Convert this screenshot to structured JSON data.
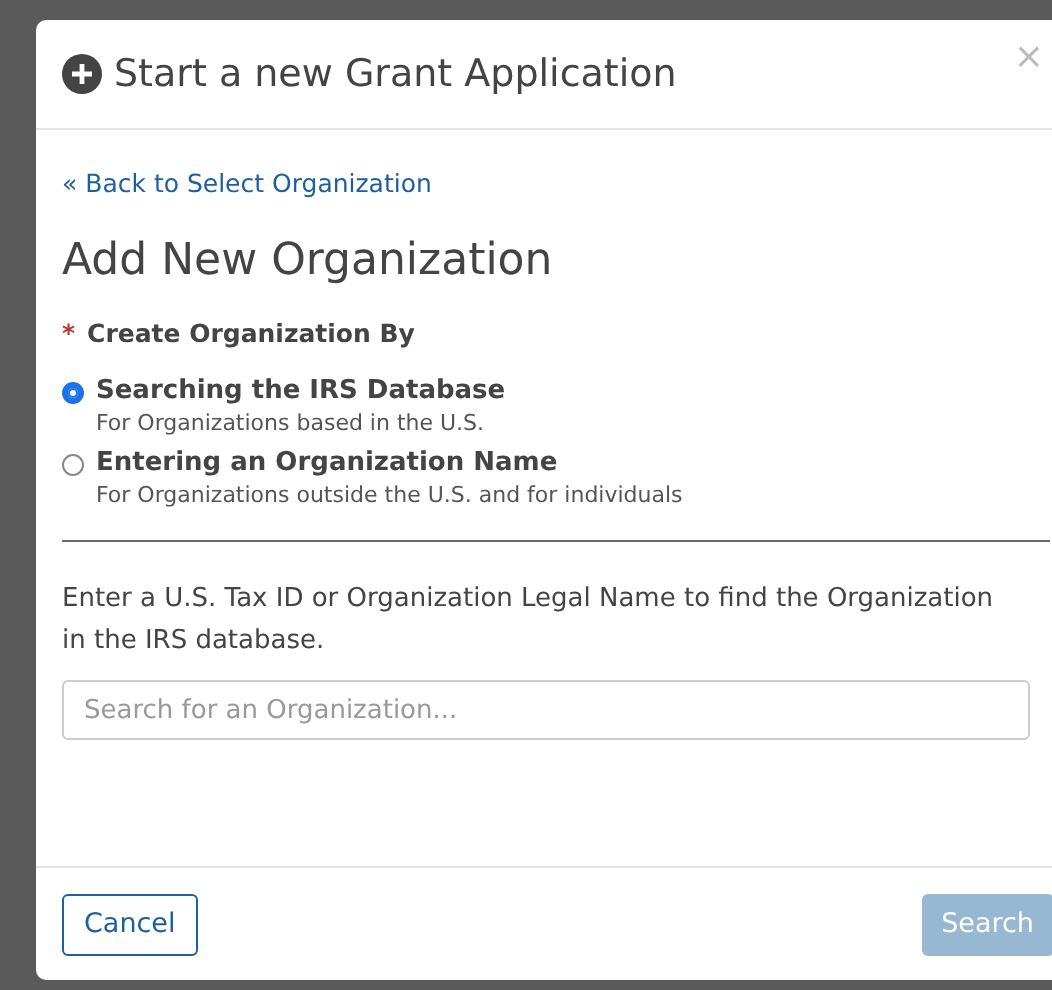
{
  "modal": {
    "title": "Start a new Grant Application",
    "close": "×"
  },
  "back_link": "« Back to Select Organization",
  "heading": "Add New Organization",
  "field": {
    "required": "*",
    "label": "Create Organization By"
  },
  "options": [
    {
      "label": "Searching the IRS Database",
      "description": "For Organizations based in the U.S.",
      "selected": true
    },
    {
      "label": "Entering an Organization Name",
      "description": "For Organizations outside the U.S. and for individuals",
      "selected": false
    }
  ],
  "instructions": "Enter a U.S. Tax ID or Organization Legal Name to find the Organization in the IRS database.",
  "search": {
    "placeholder": "Search for an Organization..."
  },
  "buttons": [
    {
      "label": "Cancel",
      "kind": "secondary",
      "disabled": false
    },
    {
      "label": "Search",
      "kind": "primary",
      "disabled": true
    }
  ]
}
